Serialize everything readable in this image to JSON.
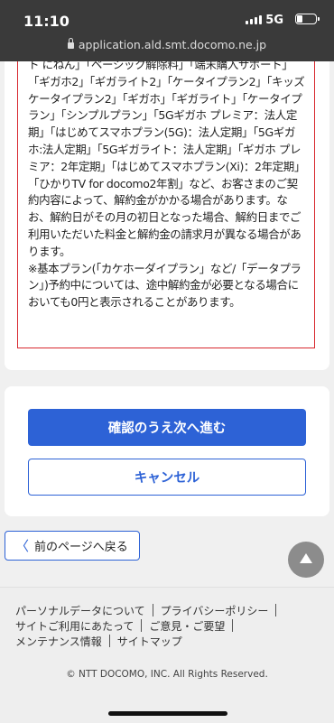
{
  "status": {
    "time": "11:10",
    "network": "5G"
  },
  "browser": {
    "url": "application.ald.smt.docomo.ne.jp"
  },
  "notice": {
    "text": "ト にねん」「ベーシック解除料」「端末購入サポート」「ギガホ2」「ギガライト2」「ケータイプラン2」「キッズケータイプラン2」「ギガホ」「ギガライト」「ケータイプラン」「シンプルプラン」「5Gギガホ プレミア：法人定期」「はじめてスマホプラン(5G)：法人定期」「5Gギガホ:法人定期」「5Gギガライト：法人定期」「ギガホ プレミア：2年定期」「はじめてスマホプラン(Xi)：2年定期」「ひかりTV for docomo2年割」など、お客さまのご契約内容によって、解約金がかかる場合があります。なお、解約日がその月の初日となった場合、解約日までご利用いただいた料金と解約金の請求月が異なる場合があります。\n※基本プラン(「カケホーダイプラン」など/「データプラン」)予約中については、途中解約金が必要となる場合においても0円と表示されることがあります。"
  },
  "buttons": {
    "confirm": "確認のうえ次へ進む",
    "cancel": "キャンセル",
    "back": "前のページへ戻る"
  },
  "footer": {
    "links": [
      "パーソナルデータについて",
      "プライバシーポリシー",
      "サイトご利用にあたって",
      "ご意見・ご要望",
      "メンテナンス情報",
      "サイトマップ"
    ],
    "copyright": "© NTT DOCOMO, INC. All Rights Reserved."
  }
}
